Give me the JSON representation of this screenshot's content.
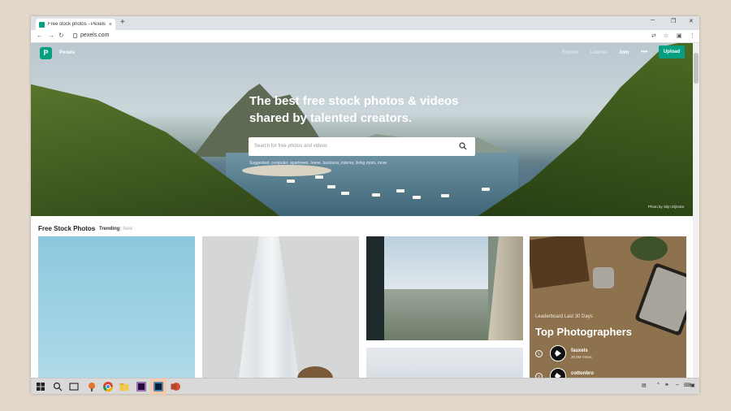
{
  "browser": {
    "tab_title": "Free stock photos - Pexels",
    "url": "pexels.com",
    "new_tab": "+",
    "tab_close": "×"
  },
  "header": {
    "logo_letter": "P",
    "brand": "Pexels",
    "nav": [
      "Explore",
      "License",
      "Join"
    ],
    "more": "•••",
    "upload": "Upload"
  },
  "hero": {
    "headline_1": "The best free stock photos & videos",
    "headline_2": "shared by talented creators.",
    "search_placeholder": "Search for free photos and videos",
    "suggested": "Suggested: computer, apartment, home, business, interior, living room, more",
    "credit": "Photo by Stijn Dijkstra"
  },
  "section": {
    "title": "Free Stock Photos",
    "trending": "Trending",
    "new": "| New"
  },
  "leaderboard": {
    "label": "Leaderboard Last 30 Days",
    "title": "Top Photographers",
    "photographers": [
      {
        "rank": "1",
        "name": "fauxels",
        "views": "30.8M Views"
      },
      {
        "rank": "2",
        "name": "cottonbro",
        "views": ""
      }
    ]
  },
  "colors": {
    "brand_green": "#05a081",
    "taskbar": "#d9d9d9"
  }
}
